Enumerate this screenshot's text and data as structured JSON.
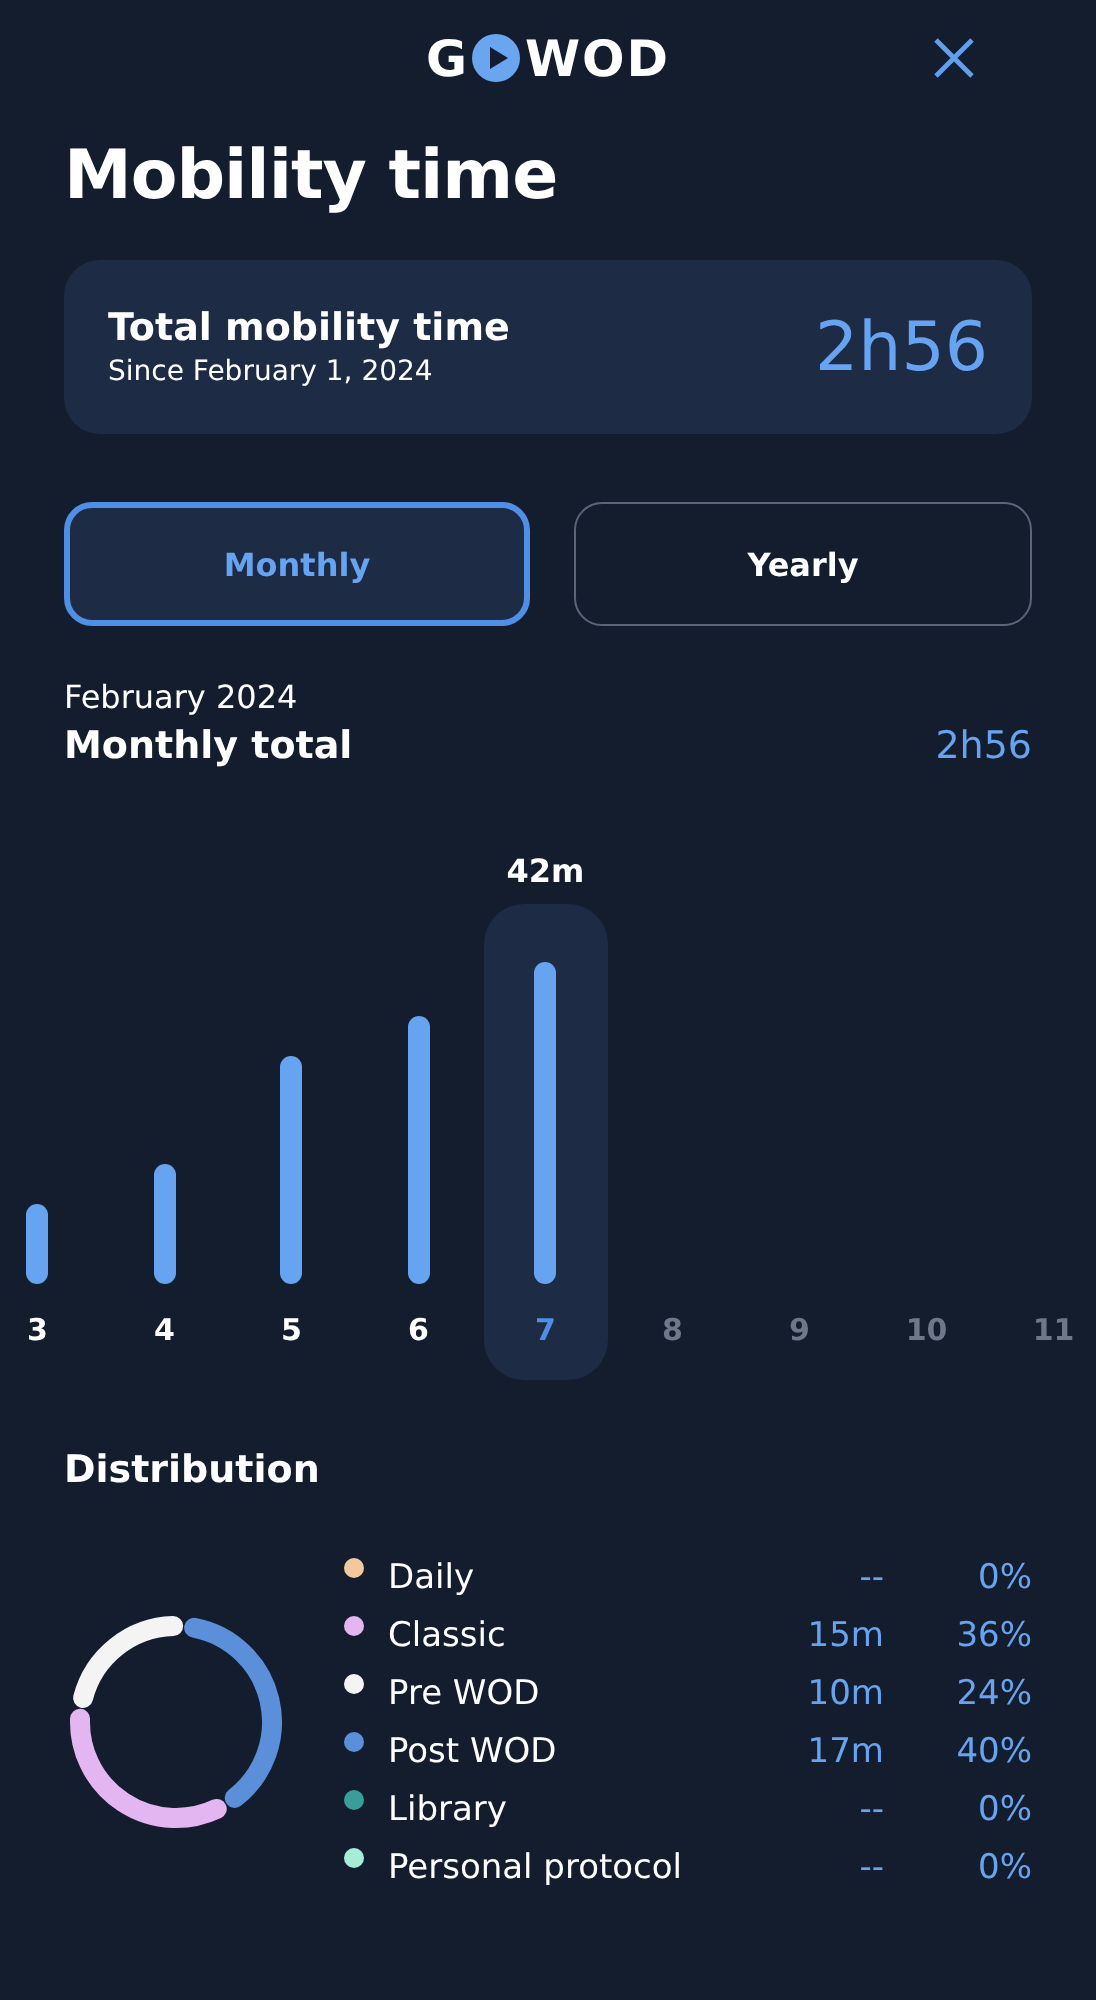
{
  "header": {
    "logo_start": "G",
    "logo_end": "WOD"
  },
  "title": "Mobility time",
  "summary": {
    "label": "Total mobility time",
    "since": "Since February 1, 2024",
    "value": "2h56"
  },
  "tabs": [
    {
      "label": "Monthly",
      "selected": true
    },
    {
      "label": "Yearly",
      "selected": false
    }
  ],
  "period": {
    "month": "February 2024",
    "label": "Monthly total",
    "value": "2h56"
  },
  "days": [
    {
      "label": "3",
      "selected": false,
      "disabled": false
    },
    {
      "label": "4",
      "selected": false,
      "disabled": false
    },
    {
      "label": "5",
      "selected": false,
      "disabled": false
    },
    {
      "label": "6",
      "selected": false,
      "disabled": false
    },
    {
      "label": "7",
      "selected": true,
      "disabled": false,
      "value": "42m"
    },
    {
      "label": "8",
      "selected": false,
      "disabled": true
    },
    {
      "label": "9",
      "selected": false,
      "disabled": true
    },
    {
      "label": "10",
      "selected": false,
      "disabled": true
    },
    {
      "label": "11",
      "selected": false,
      "disabled": true
    }
  ],
  "distribution": {
    "title": "Distribution",
    "items": [
      {
        "name": "Daily",
        "color": "#f2c89c",
        "time": "--",
        "percent": "0%"
      },
      {
        "name": "Classic",
        "color": "#e3b6f2",
        "time": "15m",
        "percent": "36%"
      },
      {
        "name": "Pre WOD",
        "color": "#f4f4f4",
        "time": "10m",
        "percent": "24%"
      },
      {
        "name": "Post WOD",
        "color": "#5b8fd9",
        "time": "17m",
        "percent": "40%"
      },
      {
        "name": "Library",
        "color": "#3a9e98",
        "time": "--",
        "percent": "0%"
      },
      {
        "name": "Personal protocol",
        "color": "#a6ecd6",
        "time": "--",
        "percent": "0%"
      }
    ]
  }
}
